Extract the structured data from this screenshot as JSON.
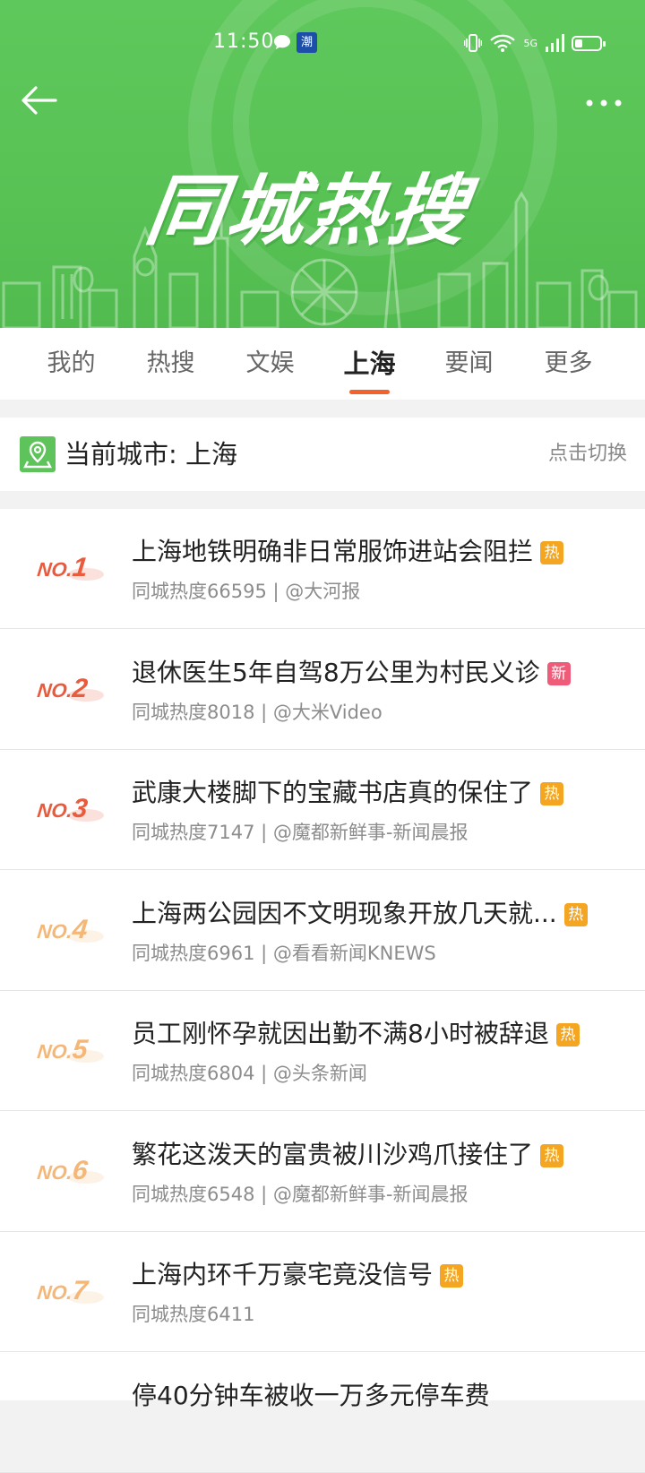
{
  "status_bar": {
    "time": "11:50",
    "app_badge": "潮",
    "network": "5G"
  },
  "header": {
    "banner_title": "同城热搜"
  },
  "tabs": [
    {
      "label": "我的",
      "active": false
    },
    {
      "label": "热搜",
      "active": false
    },
    {
      "label": "文娱",
      "active": false
    },
    {
      "label": "上海",
      "active": true
    },
    {
      "label": "要闻",
      "active": false
    },
    {
      "label": "更多",
      "active": false
    }
  ],
  "city": {
    "label": "当前城市: 上海",
    "switch_label": "点击切换"
  },
  "colors": {
    "brand_green": "#58c255",
    "accent_orange": "#f2632b",
    "hot_tag": "#f4a623",
    "new_tag": "#ee5c79"
  },
  "list": [
    {
      "rank": "NO.1",
      "title": "上海地铁明确非日常服饰进站会阻拦",
      "tag": "热",
      "tag_type": "hot",
      "meta": "同城热度66595 | @大河报"
    },
    {
      "rank": "NO.2",
      "title": "退休医生5年自驾8万公里为村民义诊",
      "tag": "新",
      "tag_type": "new",
      "meta": "同城热度8018 | @大米Video"
    },
    {
      "rank": "NO.3",
      "title": "武康大楼脚下的宝藏书店真的保住了",
      "tag": "热",
      "tag_type": "hot",
      "meta": "同城热度7147 | @魔都新鲜事-新闻晨报"
    },
    {
      "rank": "NO.4",
      "title": "上海两公园因不文明现象开放几天就...",
      "tag": "热",
      "tag_type": "hot",
      "meta": "同城热度6961 | @看看新闻KNEWS"
    },
    {
      "rank": "NO.5",
      "title": "员工刚怀孕就因出勤不满8小时被辞退",
      "tag": "热",
      "tag_type": "hot",
      "meta": "同城热度6804 | @头条新闻"
    },
    {
      "rank": "NO.6",
      "title": "繁花这泼天的富贵被川沙鸡爪接住了",
      "tag": "热",
      "tag_type": "hot",
      "meta": "同城热度6548 | @魔都新鲜事-新闻晨报"
    },
    {
      "rank": "NO.7",
      "title": "上海内环千万豪宅竟没信号",
      "tag": "热",
      "tag_type": "hot",
      "meta": "同城热度6411"
    },
    {
      "rank": "",
      "title": "停40分钟车被收一万多元停车费",
      "tag": "",
      "tag_type": "",
      "meta": ""
    }
  ]
}
